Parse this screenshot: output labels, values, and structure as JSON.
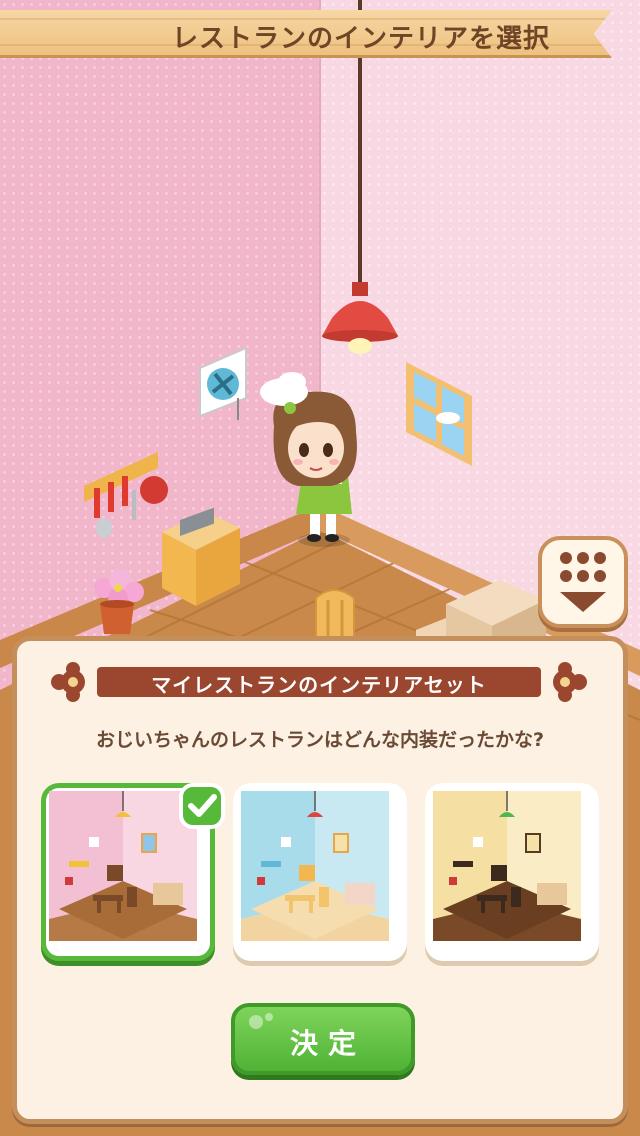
{
  "screen": {
    "title": "レストランのインテリアを選択"
  },
  "panel": {
    "header": "マイレストランのインテリアセット",
    "question": "おじいちゃんのレストランはどんな内装だったかな?",
    "options": [
      {
        "theme": "pink",
        "wall_color": "#f4c7d6",
        "lamp_color": "#f0c23a",
        "floor_color": "#b57a45",
        "selected": true
      },
      {
        "theme": "blue",
        "wall_color": "#bfe4ef",
        "lamp_color": "#e0443c",
        "floor_color": "#f1d49f",
        "selected": false
      },
      {
        "theme": "yellow",
        "wall_color": "#f8e6b5",
        "lamp_color": "#4fb64a",
        "floor_color": "#7a4a28",
        "selected": false
      }
    ],
    "confirm_label": "決定"
  },
  "colors": {
    "accent_green": "#57b93a",
    "ribbon_brown": "#9b4730",
    "frame_brown": "#c58f5c"
  },
  "icons": [
    "check-icon",
    "down-arrow-icon"
  ]
}
